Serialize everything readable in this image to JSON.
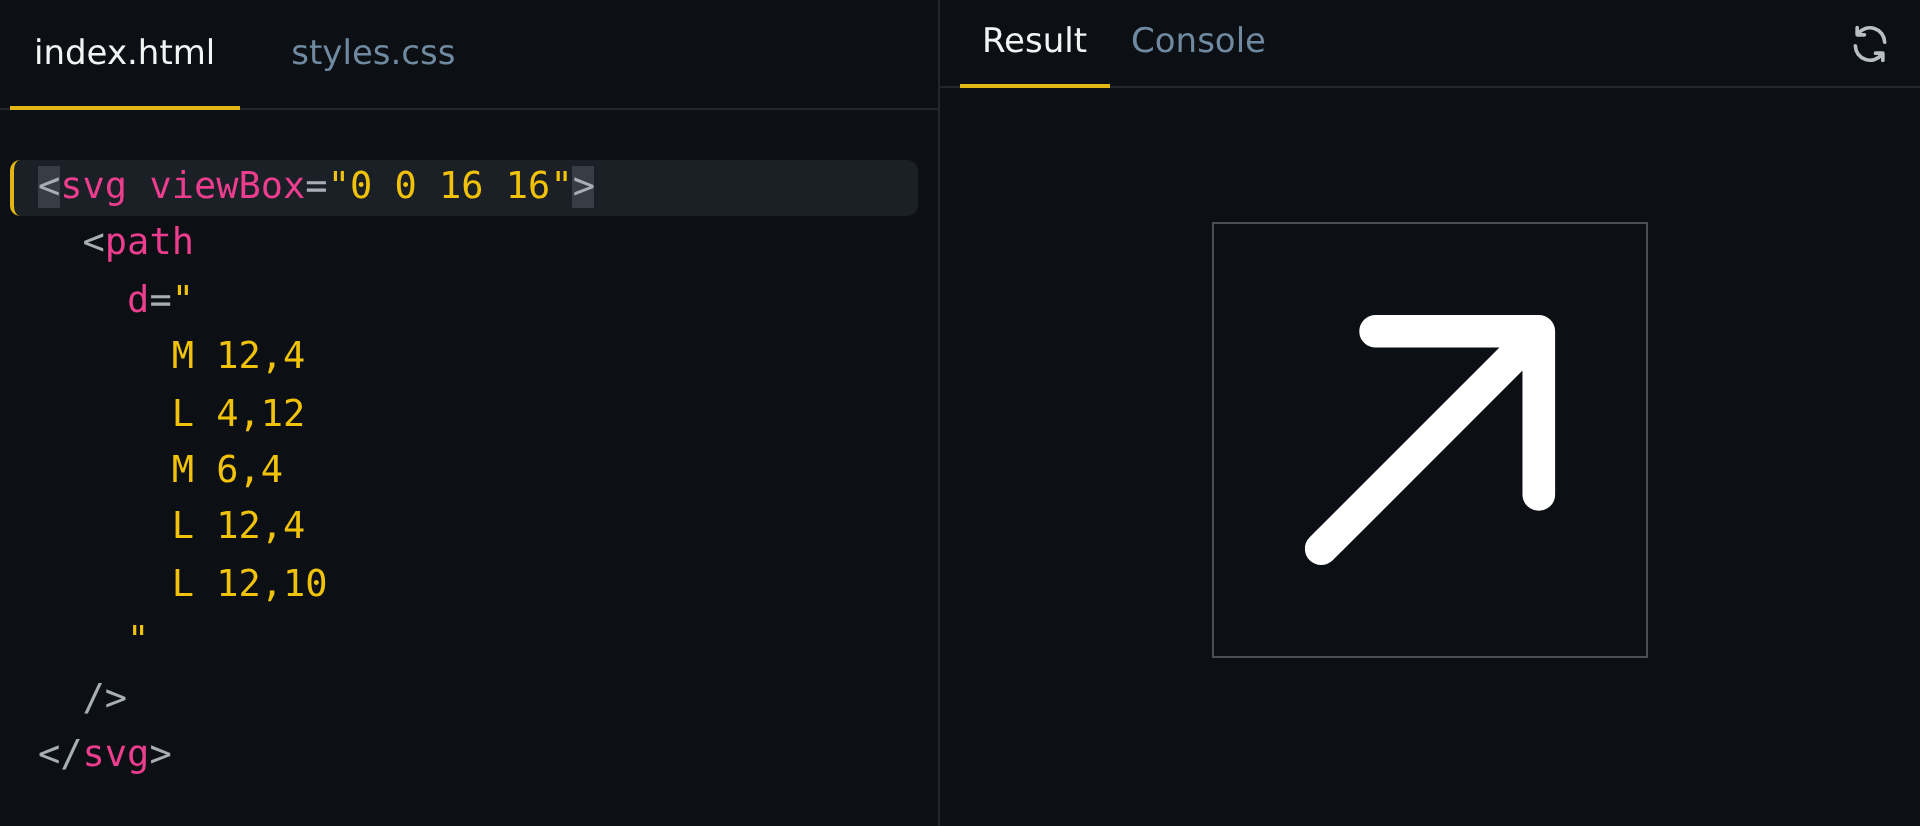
{
  "editor": {
    "tabs": [
      {
        "label": "index.html",
        "selected": true
      },
      {
        "label": "styles.css",
        "selected": false
      }
    ],
    "lines": [
      {
        "current": true,
        "tokens": [
          {
            "t": "<",
            "kind": "bracket"
          },
          {
            "t": "svg",
            "kind": "tag"
          },
          {
            "t": " viewBox",
            "kind": "tag"
          },
          {
            "t": "=",
            "kind": "punct"
          },
          {
            "t": "\"0 0 16 16\"",
            "kind": "string"
          },
          {
            "t": ">",
            "kind": "bracket"
          }
        ]
      },
      {
        "current": false,
        "tokens": [
          {
            "t": "  <",
            "kind": "punct"
          },
          {
            "t": "path",
            "kind": "tag"
          }
        ]
      },
      {
        "current": false,
        "tokens": [
          {
            "t": "    d",
            "kind": "tag"
          },
          {
            "t": "=",
            "kind": "punct"
          },
          {
            "t": "\"",
            "kind": "string"
          }
        ]
      },
      {
        "current": false,
        "tokens": [
          {
            "t": "      M 12,4",
            "kind": "string"
          }
        ]
      },
      {
        "current": false,
        "tokens": [
          {
            "t": "      L 4,12",
            "kind": "string"
          }
        ]
      },
      {
        "current": false,
        "tokens": [
          {
            "t": "      M 6,4",
            "kind": "string"
          }
        ]
      },
      {
        "current": false,
        "tokens": [
          {
            "t": "      L 12,4",
            "kind": "string"
          }
        ]
      },
      {
        "current": false,
        "tokens": [
          {
            "t": "      L 12,10",
            "kind": "string"
          }
        ]
      },
      {
        "current": false,
        "tokens": [
          {
            "t": "    \"",
            "kind": "string"
          }
        ]
      },
      {
        "current": false,
        "tokens": [
          {
            "t": "  />",
            "kind": "punct"
          }
        ]
      },
      {
        "current": false,
        "tokens": [
          {
            "t": "</",
            "kind": "punct"
          },
          {
            "t": "svg",
            "kind": "tag"
          },
          {
            "t": ">",
            "kind": "punct"
          }
        ]
      }
    ]
  },
  "preview": {
    "tabs": [
      {
        "label": "Result",
        "selected": true
      },
      {
        "label": "Console",
        "selected": false
      }
    ]
  }
}
